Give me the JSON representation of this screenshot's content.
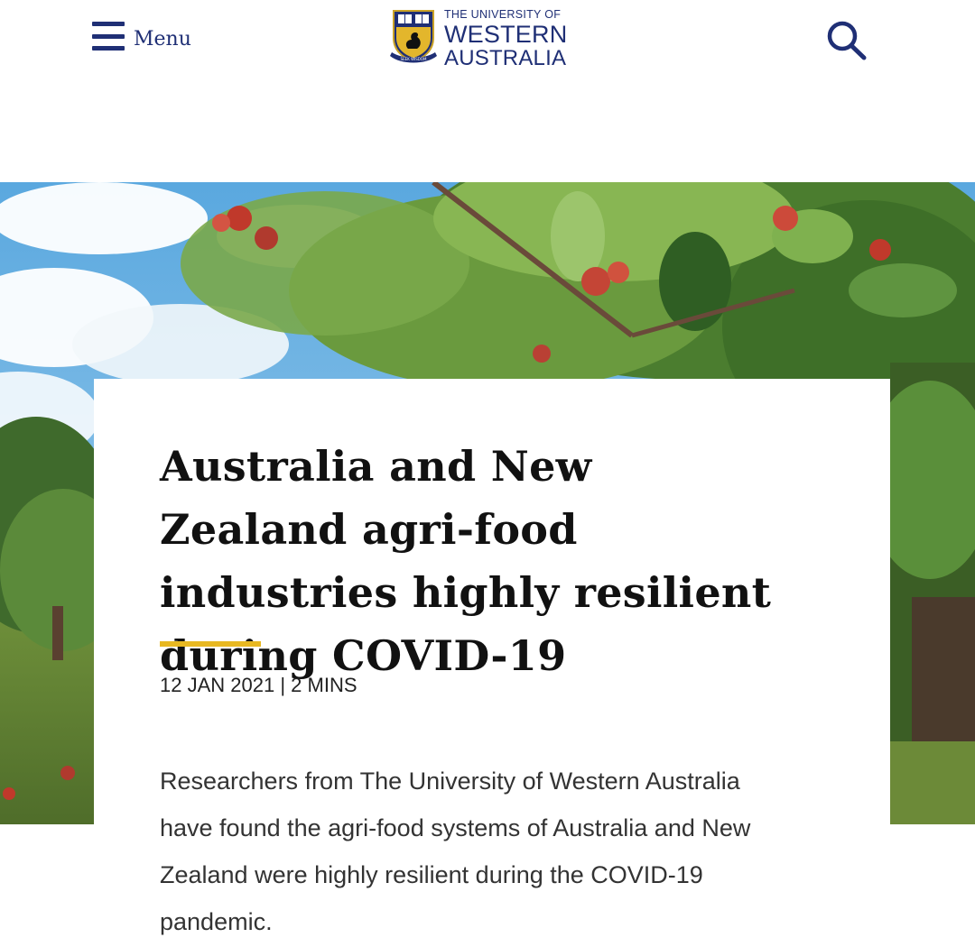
{
  "header": {
    "menu_label": "Menu",
    "logo": {
      "line1": "THE UNIVERSITY OF",
      "line2": "WESTERN",
      "line3": "AUSTRALIA",
      "motto": "SEEK WISDOM"
    },
    "search_icon": "search-icon",
    "menu_icon": "hamburger-icon"
  },
  "colors": {
    "brand_blue": "#1f2f75",
    "brand_gold": "#e8b821",
    "text": "#111111"
  },
  "hero": {
    "image": "apple-orchard-photo"
  },
  "article": {
    "title": "Australia and New Zealand agri-food industries highly resilient during COVID-19",
    "date": "12 JAN 2021",
    "separator": "|",
    "read_time": "2 MINS",
    "summary": "Researchers from The University of Western Australia have found the agri-food systems of Australia and New Zealand were highly resilient during the COVID-19 pandemic."
  }
}
